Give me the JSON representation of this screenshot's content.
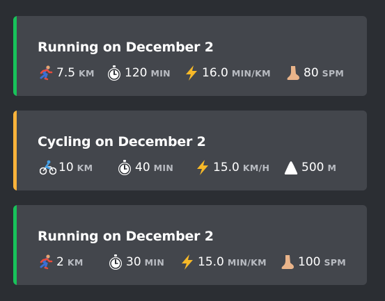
{
  "colors": {
    "background": "#2b2e33",
    "card": "#43464c",
    "running_accent": "#18c25a",
    "cycling_accent": "#fbb33b"
  },
  "activities": [
    {
      "title": "Running on December 2",
      "accent": "#18c25a",
      "stats": [
        {
          "icon": "runner-icon",
          "value": "7.5",
          "unit": "KM"
        },
        {
          "icon": "stopwatch-icon",
          "value": "120",
          "unit": "MIN"
        },
        {
          "icon": "lightning-icon",
          "value": "16.0",
          "unit": "MIN/KM"
        },
        {
          "icon": "foot-icon",
          "value": "80",
          "unit": "SPM"
        }
      ]
    },
    {
      "title": "Cycling on December 2",
      "accent": "#fbb33b",
      "stats": [
        {
          "icon": "cyclist-icon",
          "value": "10",
          "unit": "KM"
        },
        {
          "icon": "stopwatch-icon",
          "value": "40",
          "unit": "MIN"
        },
        {
          "icon": "lightning-icon",
          "value": "15.0",
          "unit": "KM/H"
        },
        {
          "icon": "mountain-icon",
          "value": "500",
          "unit": "M"
        }
      ]
    },
    {
      "title": "Running on December 2",
      "accent": "#18c25a",
      "stats": [
        {
          "icon": "runner-icon",
          "value": "2",
          "unit": "KM"
        },
        {
          "icon": "stopwatch-icon",
          "value": "30",
          "unit": "MIN"
        },
        {
          "icon": "lightning-icon",
          "value": "15.0",
          "unit": "MIN/KM"
        },
        {
          "icon": "foot-icon",
          "value": "100",
          "unit": "SPM"
        }
      ]
    }
  ]
}
